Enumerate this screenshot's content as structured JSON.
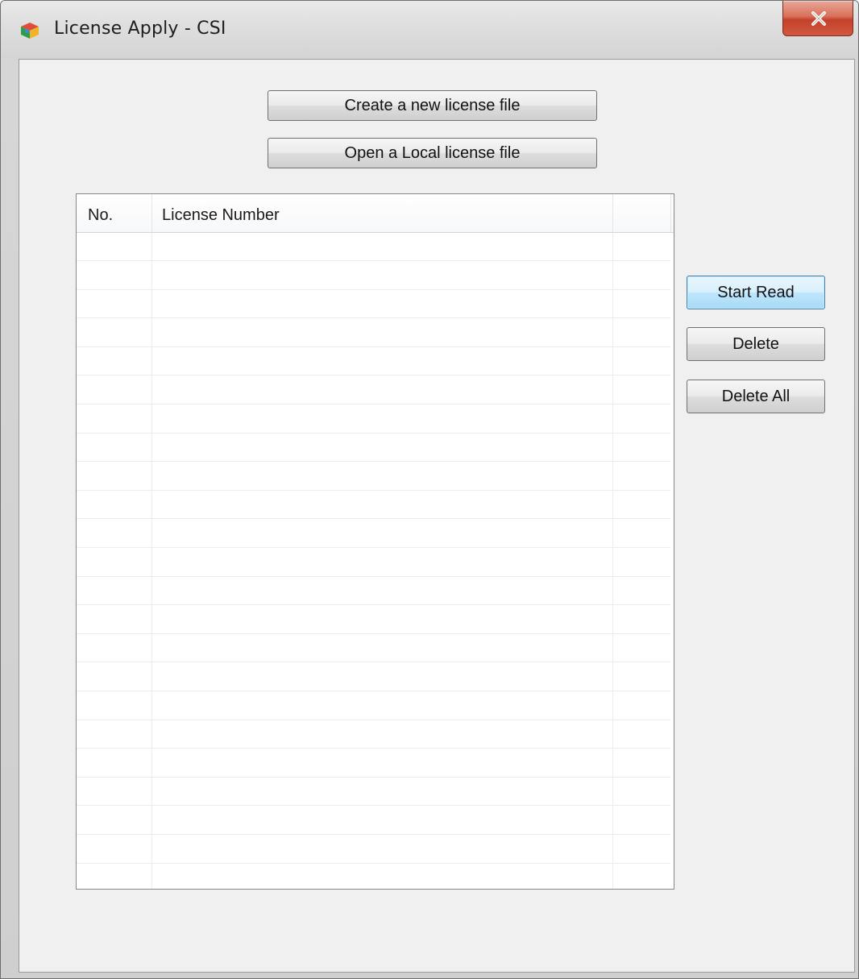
{
  "window": {
    "title": "License Apply - CSI",
    "app_icon": "colored-cube-icon",
    "close_icon": "close-icon"
  },
  "actions": {
    "create_label": "Create a new license file",
    "open_label": "Open a Local license file"
  },
  "side_buttons": {
    "start_read_label": "Start Read",
    "delete_label": "Delete",
    "delete_all_label": "Delete All"
  },
  "list": {
    "columns": [
      "No.",
      "License Number",
      ""
    ],
    "rows": []
  },
  "colors": {
    "client_background": "#f0f0f0",
    "close_button": "#c4422b",
    "default_button_border": "#3c7fb1"
  }
}
